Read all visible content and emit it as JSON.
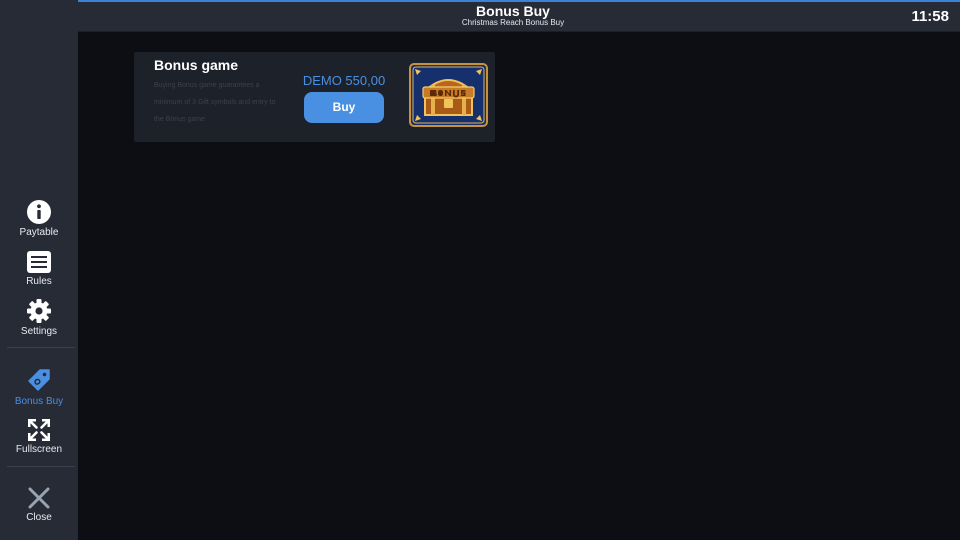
{
  "header": {
    "title": "Bonus Buy",
    "subtitle": "Christmas Reach Bonus Buy",
    "clock": "11:58"
  },
  "sidebar": {
    "items": [
      {
        "label": "Paytable",
        "icon": "info-icon"
      },
      {
        "label": "Rules",
        "icon": "list-icon"
      },
      {
        "label": "Settings",
        "icon": "gear-icon"
      },
      {
        "label": "Bonus Buy",
        "icon": "tag-icon",
        "active": true
      },
      {
        "label": "Fullscreen",
        "icon": "fullscreen-icon"
      },
      {
        "label": "Close",
        "icon": "close-icon"
      }
    ]
  },
  "bonus_card": {
    "title": "Bonus game",
    "description": "Buying Bonus game guarantees a minimum of 3 Gift symbols and entry to the Bonus game",
    "price": "DEMO 550,00",
    "buy_label": "Buy",
    "image_text": "BONUS"
  },
  "colors": {
    "accent": "#4a90e2",
    "sidebar_bg": "#262b35",
    "page_bg": "#0c0e13",
    "card_bg": "#1d212a"
  }
}
